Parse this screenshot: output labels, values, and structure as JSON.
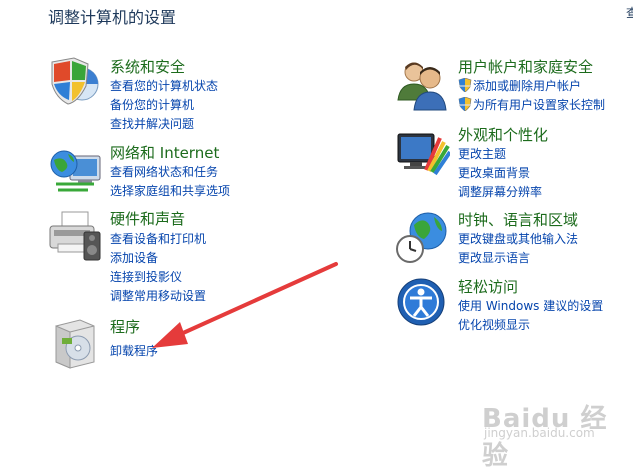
{
  "page": {
    "title": "调整计算机的设置",
    "right_edge_fragment": "查"
  },
  "left_categories": [
    {
      "title": "系统和安全",
      "links": [
        "查看您的计算机状态",
        "备份您的计算机",
        "查找并解决问题"
      ]
    },
    {
      "title": "网络和 Internet",
      "links": [
        "查看网络状态和任务",
        "选择家庭组和共享选项"
      ]
    },
    {
      "title": "硬件和声音",
      "links": [
        "查看设备和打印机",
        "添加设备",
        "连接到投影仪",
        "调整常用移动设置"
      ]
    },
    {
      "title": "程序",
      "links": [
        "卸载程序"
      ]
    }
  ],
  "right_categories": [
    {
      "title": "用户帐户和家庭安全",
      "links": [
        "添加或删除用户帐户",
        "为所有用户设置家长控制"
      ]
    },
    {
      "title": "外观和个性化",
      "links": [
        "更改主题",
        "更改桌面背景",
        "调整屏幕分辨率"
      ]
    },
    {
      "title": "时钟、语言和区域",
      "links": [
        "更改键盘或其他输入法",
        "更改显示语言"
      ]
    },
    {
      "title": "轻松访问",
      "links": [
        "使用 Windows 建议的设置",
        "优化视频显示"
      ]
    }
  ],
  "watermark": {
    "logo": "Baidu 经验",
    "url": "jingyan.baidu.com"
  },
  "colors": {
    "title_green": "#1c6b1c",
    "link_blue": "#0645ad",
    "heading_navy": "#1e395b",
    "arrow_red": "#e53b3b"
  },
  "icons": {
    "system_security": "shield-chart-icon",
    "network": "globe-network-icon",
    "hardware": "printer-icon",
    "programs": "software-box-icon",
    "user_accounts": "users-icon",
    "appearance": "monitor-palette-icon",
    "clock_region": "globe-clock-icon",
    "ease_of_access": "accessibility-icon",
    "uac": "uac-shield-icon"
  }
}
